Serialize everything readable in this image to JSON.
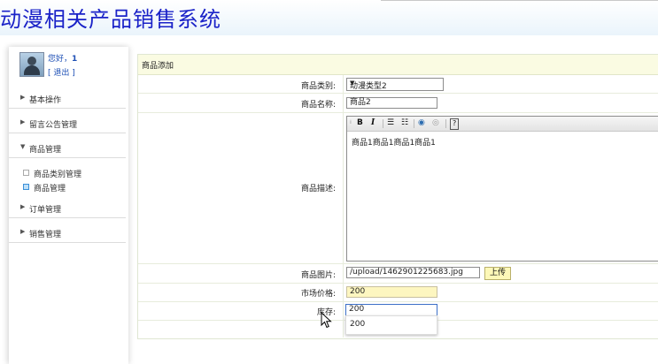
{
  "header": {
    "title": "动漫相关产品销售系统"
  },
  "user": {
    "greeting": "您好，",
    "name": "1",
    "logout": "[ 退出 ]"
  },
  "sidebar": {
    "sections": [
      {
        "label": "基本操作",
        "expanded": false
      },
      {
        "label": "留言公告管理",
        "expanded": false
      },
      {
        "label": "商品管理",
        "expanded": true
      },
      {
        "label": "订单管理",
        "expanded": false
      },
      {
        "label": "销售管理",
        "expanded": false
      }
    ],
    "sub_items": [
      {
        "label": "商品类别管理",
        "active": false
      },
      {
        "label": "商品管理",
        "active": true
      }
    ]
  },
  "form": {
    "title": "商品添加",
    "category": {
      "label": "商品类别:",
      "value": "动漫类型2"
    },
    "name": {
      "label": "商品名称:",
      "value": "商品2"
    },
    "description": {
      "label": "商品描述:",
      "value": "商品1商品1商品1商品1"
    },
    "image": {
      "label": "商品图片:",
      "value": "/upload/1462901225683.jpg",
      "button": "上传"
    },
    "price": {
      "label": "市场价格:",
      "value": "200"
    },
    "stock": {
      "label": "库存:",
      "value": "200"
    },
    "autocomplete": {
      "suggestion": "200"
    }
  },
  "toolbar": {
    "bold": "B",
    "italic": "I",
    "help": "?"
  },
  "colors": {
    "title": "#1a22c8",
    "link": "#1d4fb5",
    "panel_header": "#fafbe2",
    "input_highlight": "#fdf6c0"
  }
}
